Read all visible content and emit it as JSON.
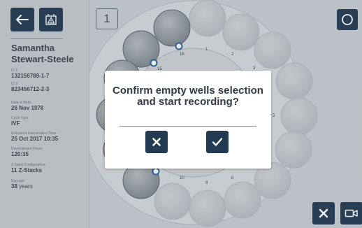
{
  "sidebar": {
    "patient_name": "Samantha Stewart-Steele",
    "fields": [
      {
        "label": "ID 1:",
        "value": "132156789-1-7"
      },
      {
        "label": "ID 2:",
        "value": "823456712-2-3"
      },
      {
        "label": "Date of Birth:",
        "value": "26 Nov 1978"
      },
      {
        "label": "Cycle Type:",
        "value": "IVF"
      },
      {
        "label": "Estimated Insemination Time:",
        "value": "25 Oct 2017 10:35"
      },
      {
        "label": "Development Hours:",
        "value": "120:35"
      },
      {
        "label": "Z-Stack Configuration:",
        "value": "11 Z-Stacks"
      },
      {
        "label": "Egg age:",
        "value": "38",
        "unit": "years"
      }
    ]
  },
  "main": {
    "dish_number": "1",
    "well_labels": [
      "1",
      "2",
      "3",
      "5",
      "8",
      "9",
      "10",
      "15",
      "16"
    ]
  },
  "modal": {
    "message": "Confirm empty wells selection and start recording?",
    "cancel_icon": "close-icon",
    "confirm_icon": "check-icon"
  },
  "icons": {
    "back": "arrow-left-icon",
    "alert": "warning-icon",
    "corner": "circle-icon",
    "stop": "close-icon",
    "camera": "video-camera-icon"
  },
  "colors": {
    "button_bg": "#223a52",
    "background": "#c9ced3",
    "modal_bg": "#ffffff",
    "text_dark": "#2f3a46",
    "selected_ring": "#2a5fa0"
  }
}
